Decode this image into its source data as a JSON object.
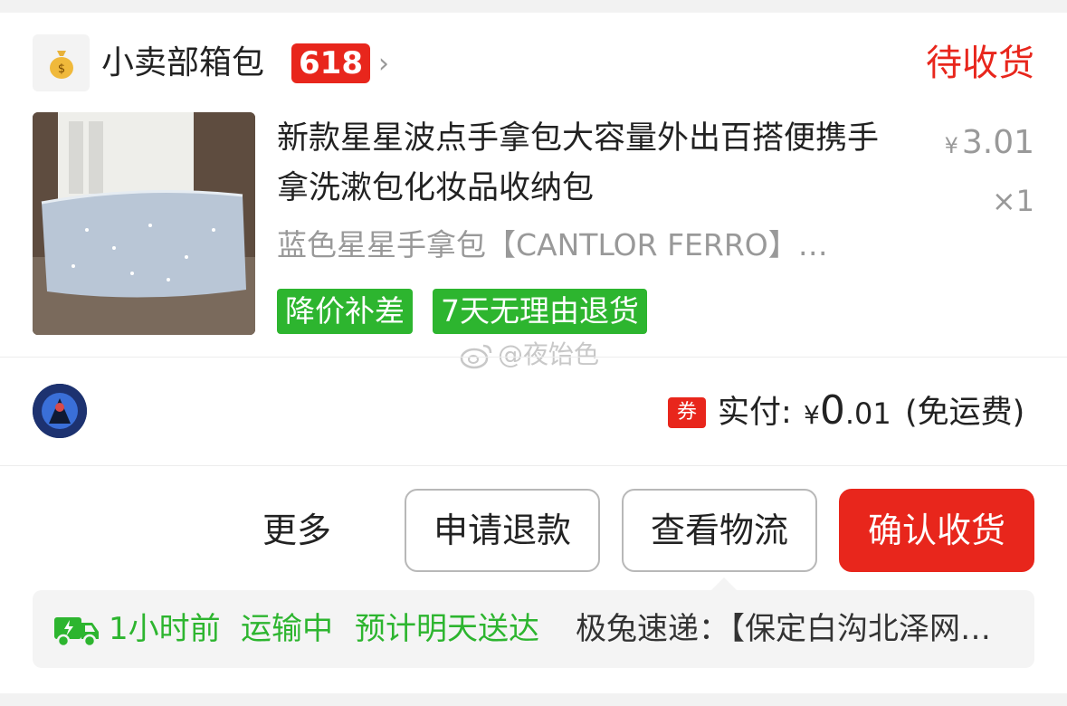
{
  "shop": {
    "name": "小卖部箱包",
    "promo_badge": "618",
    "logo_icon": "money-bag-icon",
    "status": "待收货"
  },
  "product": {
    "title": "新款星星波点手拿包大容量外出百搭便携手拿洗漱包化妆品收纳包",
    "price_symbol": "¥",
    "price": "3.01",
    "quantity": "×1",
    "sku": "蓝色星星手拿包【CANTLOR FERRO】…",
    "tags": [
      "降价补差",
      "7天无理由退货"
    ]
  },
  "watermark": "@夜饴色",
  "payment": {
    "coupon_icon_label": "券",
    "paid_label": "实付:",
    "currency_symbol": "¥",
    "amount_int": "0",
    "amount_dec": ".01",
    "shipping_note": "(免运费)"
  },
  "actions": {
    "more": "更多",
    "refund": "申请退款",
    "logistics": "查看物流",
    "confirm": "确认收货"
  },
  "logistics": {
    "time": "1小时前",
    "status": "运输中",
    "eta": "预计明天送达",
    "detail": "极兔速递：【保定白沟北泽网…"
  },
  "colors": {
    "accent_red": "#e8261c",
    "accent_green": "#2db52f",
    "muted_gray": "#999999"
  }
}
